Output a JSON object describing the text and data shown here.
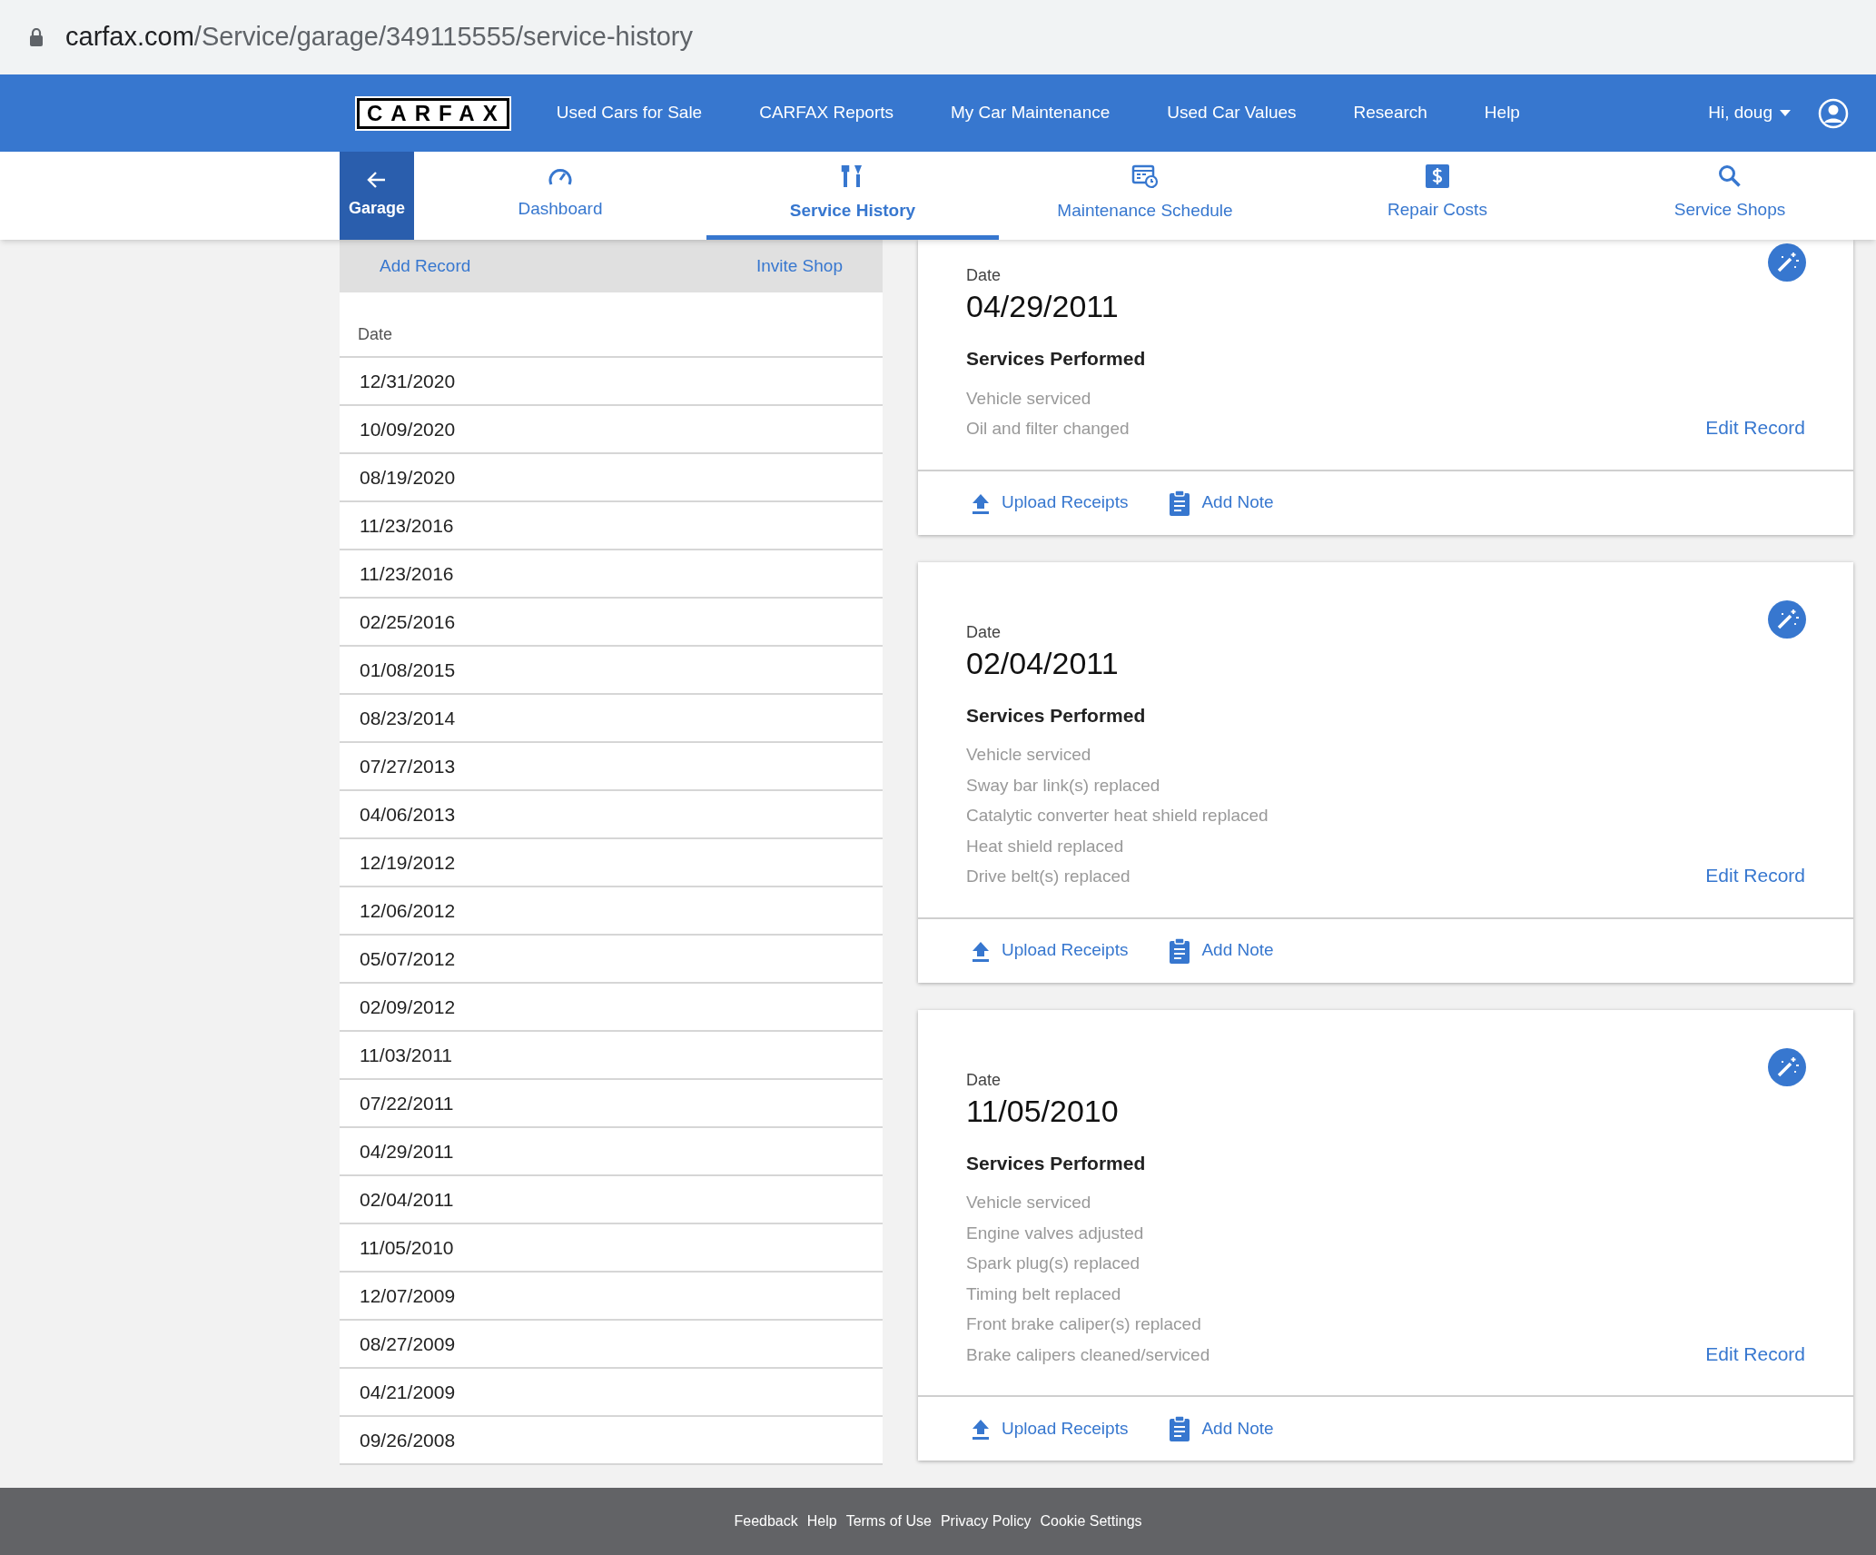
{
  "url_bar": {
    "domain": "carfax.com",
    "path": "/Service/garage/349115555/service-history"
  },
  "header": {
    "logo": "CARFAX",
    "nav": [
      "Used Cars for Sale",
      "CARFAX Reports",
      "My Car Maintenance",
      "Used Car Values",
      "Research",
      "Help"
    ],
    "user": "Hi, doug"
  },
  "back": {
    "label": "Garage"
  },
  "tabs": [
    {
      "label": "Dashboard",
      "selected": false
    },
    {
      "label": "Service History",
      "selected": true
    },
    {
      "label": "Maintenance Schedule",
      "selected": false
    },
    {
      "label": "Repair Costs",
      "selected": false
    },
    {
      "label": "Service Shops",
      "selected": false
    }
  ],
  "sidebar": {
    "actions": [
      "Add Record",
      "Invite Shop"
    ],
    "column": "Date",
    "dates": [
      "12/31/2020",
      "10/09/2020",
      "08/19/2020",
      "11/23/2016",
      "11/23/2016",
      "02/25/2016",
      "01/08/2015",
      "08/23/2014",
      "07/27/2013",
      "04/06/2013",
      "12/19/2012",
      "12/06/2012",
      "05/07/2012",
      "02/09/2012",
      "11/03/2011",
      "07/22/2011",
      "04/29/2011",
      "02/04/2011",
      "11/05/2010",
      "12/07/2009",
      "08/27/2009",
      "04/21/2009",
      "09/26/2008"
    ]
  },
  "records": [
    {
      "date_label": "Date",
      "date": "04/29/2011",
      "heading": "Services Performed",
      "services": [
        "Vehicle serviced",
        "Oil and filter changed"
      ],
      "edit": "Edit Record",
      "actions": [
        {
          "kind": "upload",
          "label": "Upload Receipts"
        },
        {
          "kind": "note",
          "label": "Add Note"
        }
      ]
    },
    {
      "date_label": "Date",
      "date": "02/04/2011",
      "heading": "Services Performed",
      "services": [
        "Vehicle serviced",
        "Sway bar link(s) replaced",
        "Catalytic converter heat shield replaced",
        "Heat shield replaced",
        "Drive belt(s) replaced"
      ],
      "edit": "Edit Record",
      "actions": [
        {
          "kind": "upload",
          "label": "Upload Receipts"
        },
        {
          "kind": "note",
          "label": "Add Note"
        }
      ]
    },
    {
      "date_label": "Date",
      "date": "11/05/2010",
      "heading": "Services Performed",
      "services": [
        "Vehicle serviced",
        "Engine valves adjusted",
        "Spark plug(s) replaced",
        "Timing belt replaced",
        "Front brake caliper(s) replaced",
        "Brake calipers cleaned/serviced"
      ],
      "edit": "Edit Record",
      "actions": [
        {
          "kind": "upload",
          "label": "Upload Receipts"
        },
        {
          "kind": "note",
          "label": "Add Note"
        }
      ]
    }
  ],
  "footer": [
    "Feedback",
    "Help",
    "Terms of Use",
    "Privacy Policy",
    "Cookie Settings"
  ]
}
